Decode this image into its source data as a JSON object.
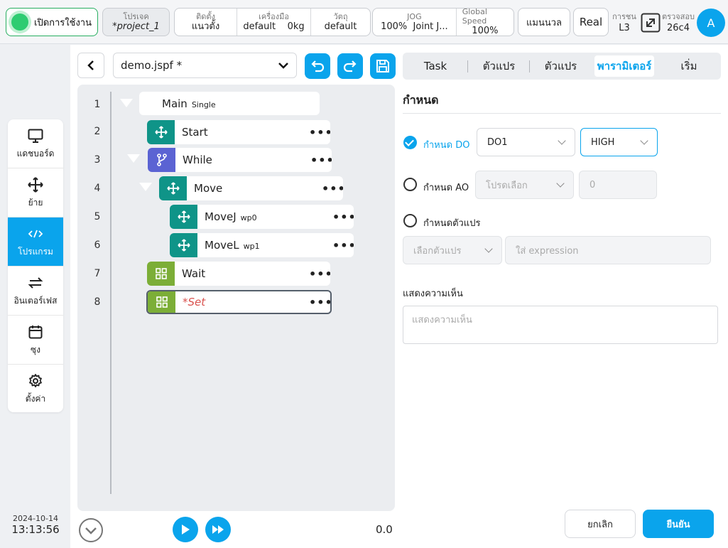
{
  "topbar": {
    "power_label": "เปิดการใช้งาน",
    "project": {
      "key": "โปรเจค",
      "value": "*project_1"
    },
    "install": {
      "key": "ติดตั้ง",
      "value": "แนวตั้ง"
    },
    "tool": {
      "key": "เครื่องมือ",
      "value": "default",
      "value2": "0kg"
    },
    "object": {
      "key": "วัตถุ",
      "value": "default"
    },
    "jog": {
      "key": "JOG",
      "value": "100%",
      "value2": "Joint J..."
    },
    "global_speed": {
      "key": "Global Speed",
      "value": "100%"
    },
    "manual_label": "แมนนวล",
    "real_label": "Real",
    "collision": {
      "key": "การชน",
      "value": "L3"
    },
    "check": {
      "key": "ตรวจสอบ",
      "value": "26c4"
    },
    "avatar_letter": "A"
  },
  "sidebar": {
    "items": [
      {
        "label": "แดชบอร์ด",
        "icon": "monitor-icon"
      },
      {
        "label": "ย้าย",
        "icon": "move-arrows-icon"
      },
      {
        "label": "โปรแกรม",
        "icon": "code-icon"
      },
      {
        "label": "อินเตอร์เฟส",
        "icon": "swap-icon"
      },
      {
        "label": "ซุง",
        "icon": "calendar-icon"
      },
      {
        "label": "ตั้งค่า",
        "icon": "gear-icon"
      }
    ],
    "active_index": 2
  },
  "clock": {
    "date": "2024-10-14",
    "time": "13:13:56"
  },
  "editor": {
    "file_name": "demo.jspf *",
    "line_numbers": [
      "1",
      "2",
      "3",
      "4",
      "5",
      "6",
      "7",
      "8"
    ],
    "nodes": {
      "main": {
        "label": "Main",
        "sub": "Single"
      },
      "start": {
        "label": "Start"
      },
      "while": {
        "label": "While"
      },
      "move": {
        "label": "Move"
      },
      "movej": {
        "label": "MoveJ",
        "sub": "wp0"
      },
      "movel": {
        "label": "MoveL",
        "sub": "wp1"
      },
      "wait": {
        "label": "Wait"
      },
      "set": {
        "label": "*Set"
      }
    },
    "more_glyph": "•••",
    "speed_value": "0.0"
  },
  "tabs": [
    "Task",
    "ตัวแปร",
    "ตัวแปร",
    "พารามิเตอร์",
    "เริ่ม"
  ],
  "active_tab": 3,
  "params": {
    "title": "กำหนด",
    "do": {
      "label": "กำหนด DO",
      "selected": true,
      "port": "DO1",
      "level": "HIGH"
    },
    "ao": {
      "label": "กำหนด AO",
      "selected": false,
      "placeholder": "โปรดเลือก",
      "value": "0"
    },
    "var": {
      "label": "กำหนดตัวแปร",
      "selected": false,
      "placeholder": "เลือกตัวแปร",
      "expr_placeholder": "ใส่ expression"
    },
    "comment_label": "แสดงความเห็น",
    "comment_placeholder": "แสดงความเห็น"
  },
  "buttons": {
    "cancel": "ยกเลิก",
    "confirm": "ยืนยัน"
  },
  "colors": {
    "accent": "#0aa4ec",
    "teal": "#0f9488",
    "purple": "#5b63d3",
    "green": "#7cae37",
    "status_on": "#2ecc71"
  }
}
